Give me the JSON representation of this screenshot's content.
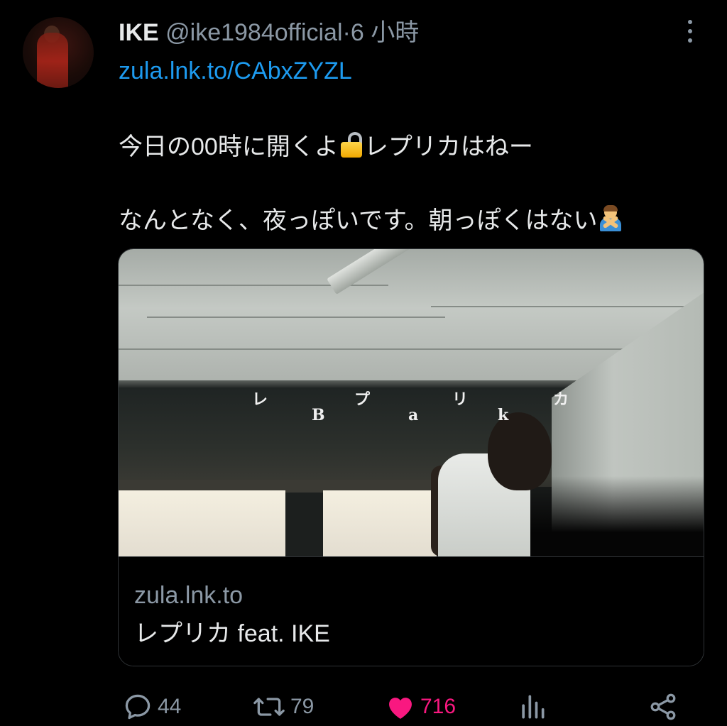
{
  "tweet": {
    "author_name": "IKE",
    "author_handle": "@ike1984official",
    "separator": "·",
    "timestamp": "6 小時",
    "link_text": "zula.lnk.to/CAbxZYZL",
    "text_line1_before": "今日の00時に開くよ",
    "text_line1_after": "レプリカはねー",
    "text_line2": "なんとなく、夜っぽいです。朝っぽくはない",
    "emoji_line1": "open-lock-emoji",
    "emoji_line2": "person-gesturing-no-emoji"
  },
  "card": {
    "image_title_letters": [
      "レ",
      "B",
      "プ",
      "a",
      "リ",
      "k",
      "カ"
    ],
    "domain": "zula.lnk.to",
    "title": "レプリカ feat. IKE"
  },
  "actions": {
    "reply_count": "44",
    "retweet_count": "79",
    "like_count": "716",
    "like_active": true,
    "like_color": "#f91880",
    "icons": [
      "reply-icon",
      "retweet-icon",
      "heart-icon",
      "views-icon",
      "share-icon"
    ]
  },
  "colors": {
    "background": "#000000",
    "link": "#1d9bf0",
    "secondary_text": "#8b98a5",
    "primary_text": "#e7e9ea"
  }
}
